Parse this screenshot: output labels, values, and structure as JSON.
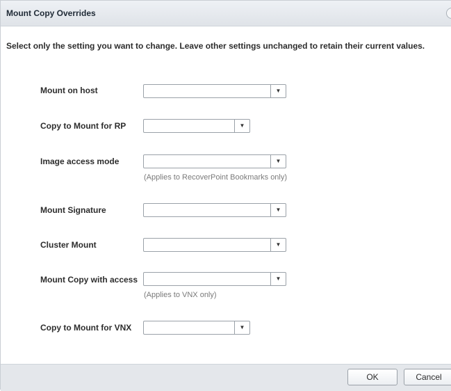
{
  "dialog": {
    "title": "Mount Copy Overrides",
    "instruction": "Select only the setting you want to change. Leave other settings unchanged to retain their current values."
  },
  "fields": {
    "mount_on_host": {
      "label": "Mount on host",
      "value": ""
    },
    "copy_to_mount_rp": {
      "label": "Copy to Mount for RP",
      "value": ""
    },
    "image_access_mode": {
      "label": "Image access mode",
      "value": "",
      "hint": "(Applies to RecoverPoint Bookmarks only)"
    },
    "mount_signature": {
      "label": "Mount Signature",
      "value": ""
    },
    "cluster_mount": {
      "label": "Cluster Mount",
      "value": ""
    },
    "mount_copy_access": {
      "label": "Mount Copy with access",
      "value": "",
      "hint": "(Applies to VNX only)"
    },
    "copy_to_mount_vnx": {
      "label": "Copy to Mount for VNX",
      "value": ""
    }
  },
  "footer": {
    "ok_label": "OK",
    "cancel_label": "Cancel"
  },
  "icons": {
    "dropdown": "chevron-down-icon",
    "close": "close-icon"
  },
  "colors": {
    "titlebar": "#dfe3e8",
    "footer": "#e4e7eb",
    "hint_text": "#7a7a7a"
  }
}
